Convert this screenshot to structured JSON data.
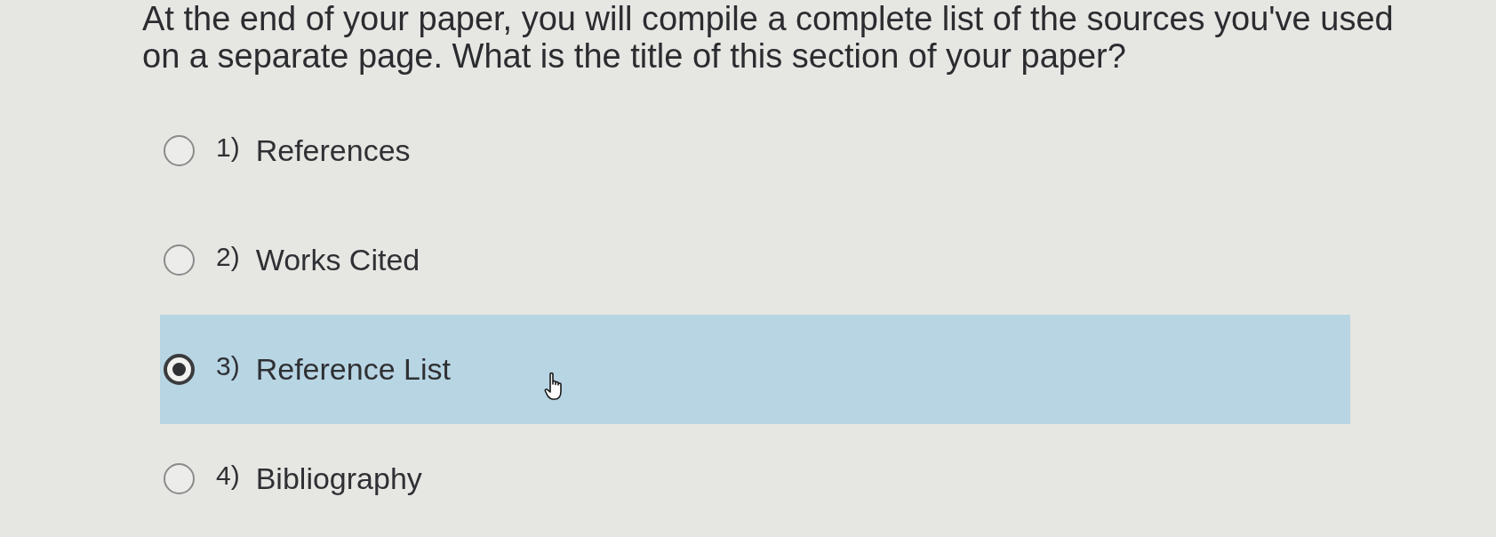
{
  "question": {
    "text": "At the end of your paper, you will compile a complete list of the sources you've used on a separate page. What is the title of this section of your paper?"
  },
  "options": [
    {
      "number": "1)",
      "label": "References",
      "selected": false
    },
    {
      "number": "2)",
      "label": "Works Cited",
      "selected": false
    },
    {
      "number": "3)",
      "label": "Reference List",
      "selected": true
    },
    {
      "number": "4)",
      "label": "Bibliography",
      "selected": false
    }
  ]
}
